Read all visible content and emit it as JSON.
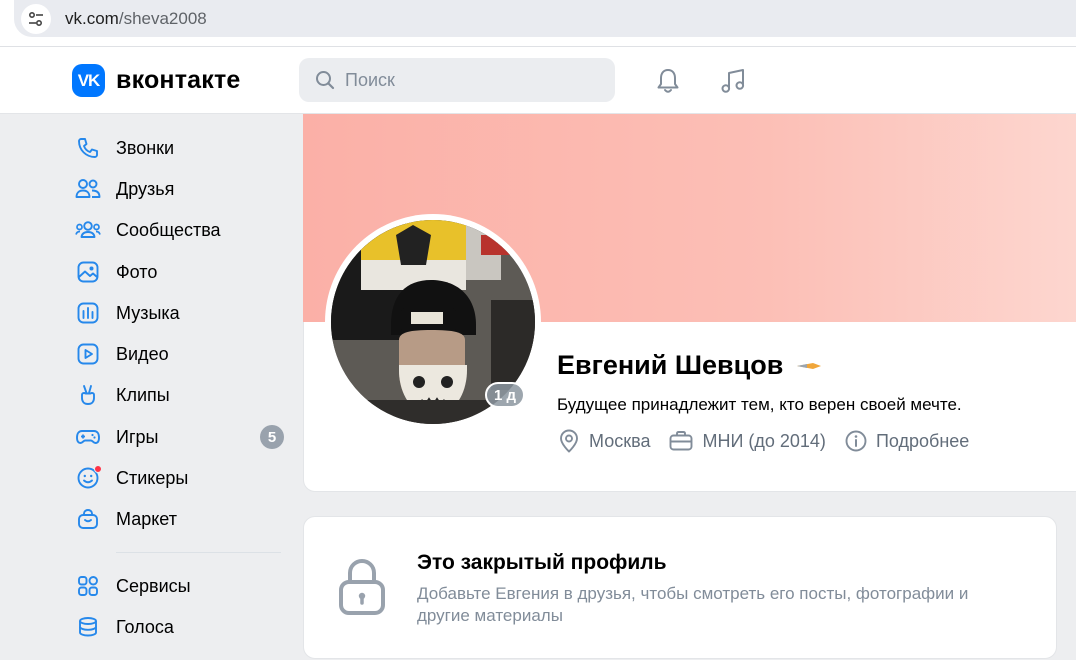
{
  "browser": {
    "url_domain": "vk.com",
    "url_path": "/sheva2008"
  },
  "header": {
    "logo_mark": "VK",
    "logo_text": "вконтакте",
    "search_placeholder": "Поиск"
  },
  "sidebar": {
    "items": [
      {
        "label": "Звонки",
        "icon": "phone-icon"
      },
      {
        "label": "Друзья",
        "icon": "friends-icon"
      },
      {
        "label": "Сообщества",
        "icon": "communities-icon"
      },
      {
        "label": "Фото",
        "icon": "photo-icon"
      },
      {
        "label": "Музыка",
        "icon": "music-icon"
      },
      {
        "label": "Видео",
        "icon": "video-icon"
      },
      {
        "label": "Клипы",
        "icon": "clips-icon"
      },
      {
        "label": "Игры",
        "icon": "games-icon",
        "badge": "5"
      },
      {
        "label": "Стикеры",
        "icon": "stickers-icon",
        "dot": true
      },
      {
        "label": "Маркет",
        "icon": "market-icon"
      },
      {
        "label": "Сервисы",
        "icon": "services-icon"
      },
      {
        "label": "Голоса",
        "icon": "votes-icon"
      }
    ]
  },
  "profile": {
    "name": "Евгений Шевцов",
    "status": "Будущее принадлежит тем, кто верен своей мечте.",
    "last_seen_badge": "1 д",
    "city": "Москва",
    "education": "МНИ (до 2014)",
    "more": "Подробнее"
  },
  "closed_profile": {
    "title": "Это закрытый профиль",
    "description": "Добавьте Евгения в друзья, чтобы смотреть его посты, фотографии и другие материалы"
  },
  "colors": {
    "accent": "#0077ff",
    "cover_start": "#fbb0a7",
    "cover_end": "#fdd6cf",
    "badge_gray": "#99a2ad",
    "notification_dot": "#ff3347",
    "secondary_text": "#818c99"
  }
}
